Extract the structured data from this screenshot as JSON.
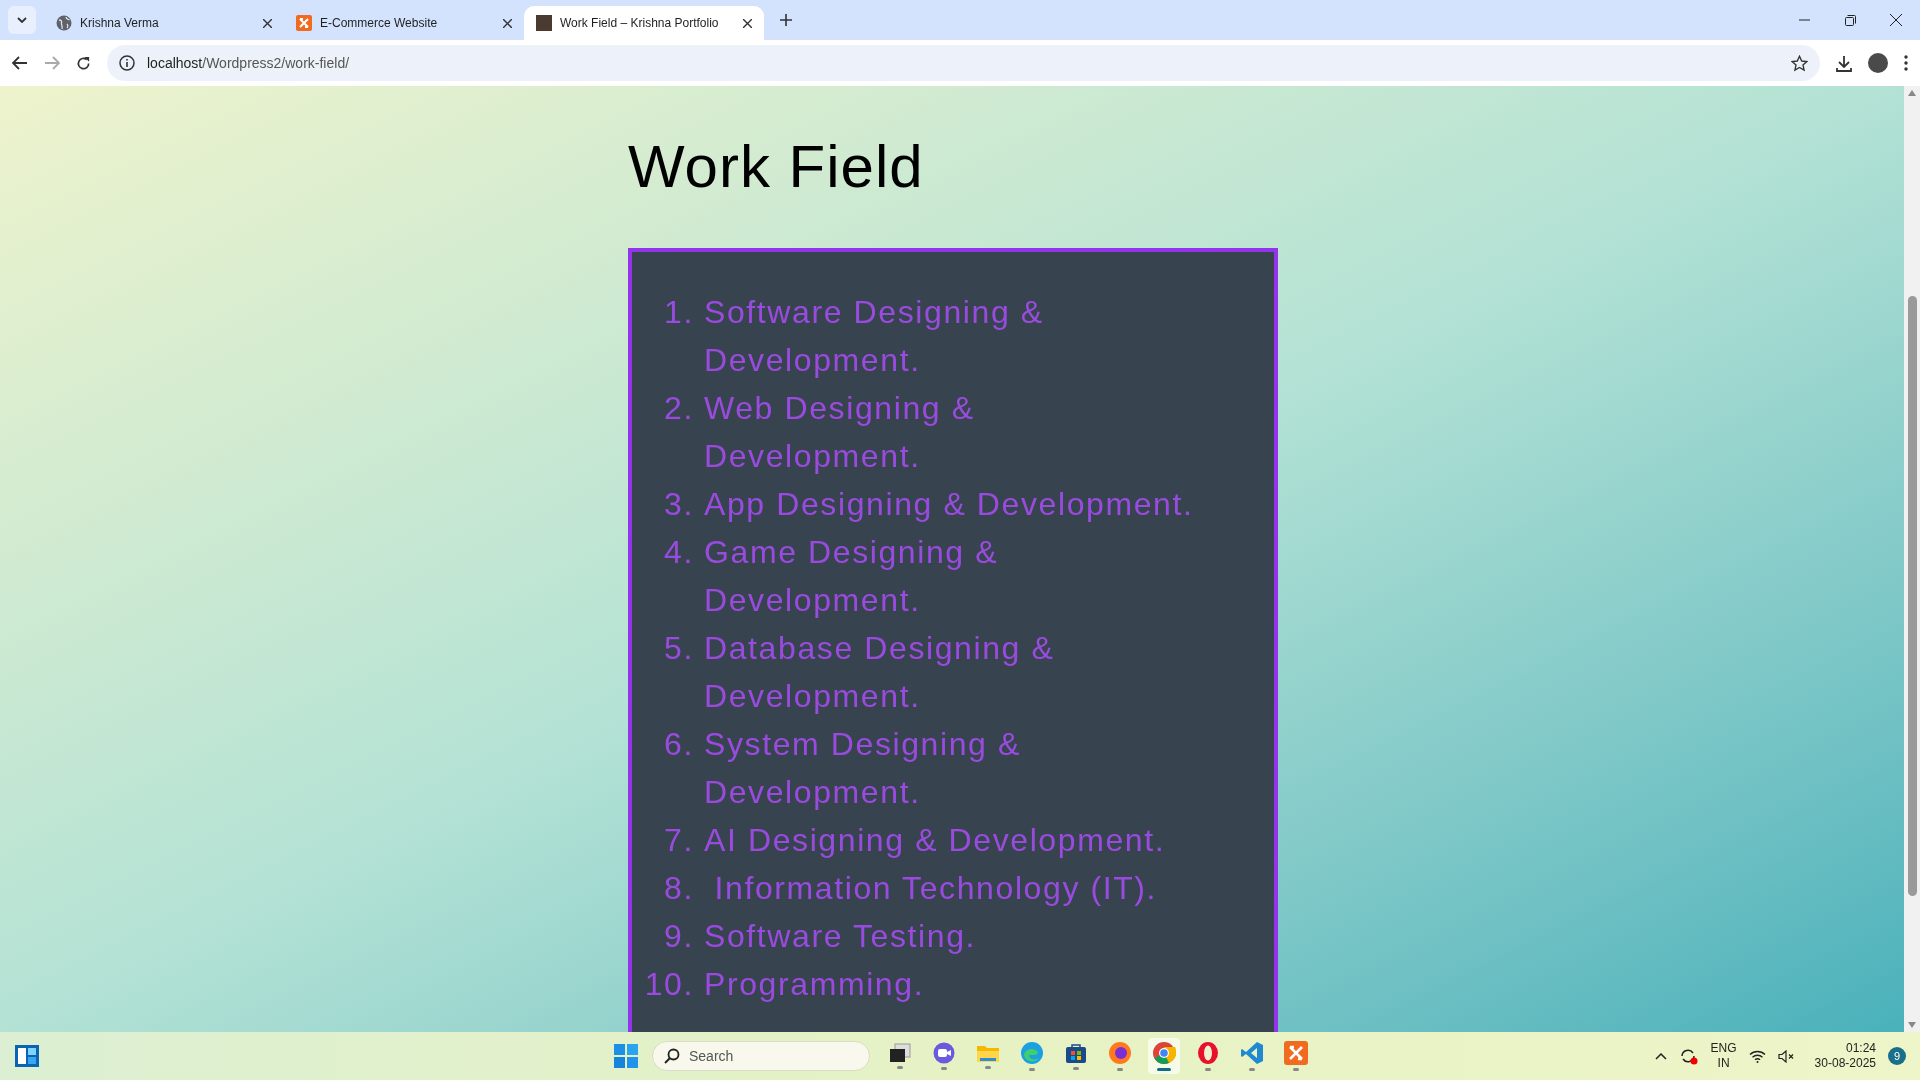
{
  "browser": {
    "tabs": [
      {
        "title": "Krishna Verma",
        "kind": "globe",
        "selected": false
      },
      {
        "title": "E-Commerce Website",
        "kind": "xampp",
        "selected": false
      },
      {
        "title": "Work Field – Krishna Portfolio",
        "kind": "photo",
        "selected": true
      }
    ],
    "address": {
      "host": "localhost",
      "path": "/Wordpress2/work-field/"
    }
  },
  "page": {
    "heading": "Work Field",
    "items": [
      {
        "number": "1.",
        "text": "Software Designing & Development."
      },
      {
        "number": "2.",
        "text": "Web Designing & Development."
      },
      {
        "number": "3.",
        "text": "App Designing & Development."
      },
      {
        "number": "4.",
        "text": "Game Designing & Development."
      },
      {
        "number": "5.",
        "text": "Database Designing & Development."
      },
      {
        "number": "6.",
        "text": "System Designing & Development."
      },
      {
        "number": "7.",
        "text": "AI Designing & Development."
      },
      {
        "number": "8.",
        "text": " Information Technology (IT)."
      },
      {
        "number": "9.",
        "text": "Software Testing."
      },
      {
        "number": "10.",
        "text": "Programming."
      }
    ]
  },
  "taskbar": {
    "search_placeholder": "Search",
    "apps": [
      {
        "kind": "taskview",
        "active": false
      },
      {
        "kind": "meet",
        "active": false
      },
      {
        "kind": "folder",
        "active": false
      },
      {
        "kind": "edge",
        "active": false
      },
      {
        "kind": "store",
        "active": false
      },
      {
        "kind": "firefox",
        "active": false
      },
      {
        "kind": "chrome",
        "active": true
      },
      {
        "kind": "opera",
        "active": false
      },
      {
        "kind": "vscode",
        "active": false
      },
      {
        "kind": "xampp",
        "active": false
      }
    ],
    "language": "ENG",
    "region": "IN",
    "time": "01:24",
    "date": "30-08-2025",
    "notifications": "9"
  }
}
